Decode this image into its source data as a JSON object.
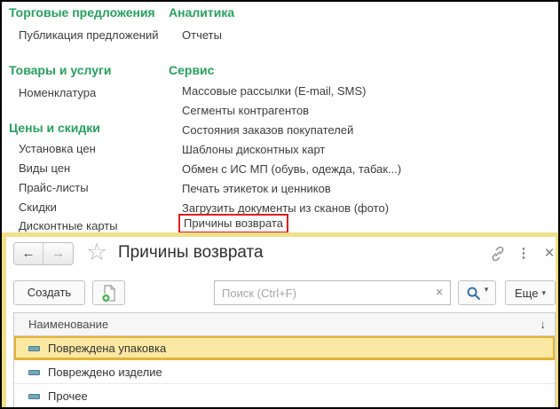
{
  "menu": {
    "col1": {
      "sec1": {
        "title": "Торговые предложения",
        "items": [
          "Публикация предложений"
        ]
      },
      "sec2": {
        "title": "Товары и услуги",
        "items": [
          "Номенклатура"
        ]
      },
      "sec3": {
        "title": "Цены и скидки",
        "items": [
          "Установка цен",
          "Виды цен",
          "Прайс-листы",
          "Скидки",
          "Дисконтные карты"
        ]
      }
    },
    "col2": {
      "sec1": {
        "title": "Аналитика",
        "items": [
          "Отчеты"
        ]
      },
      "sec2": {
        "title": "Сервис",
        "items": [
          "Массовые рассылки (E-mail, SMS)",
          "Сегменты контрагентов",
          "Состояния заказов покупателей",
          "Шаблоны дисконтных карт",
          "Обмен с ИС МП (обувь, одежда, табак...)",
          "Печать этикеток и ценников",
          "Загрузить документы из сканов (фото)",
          "Причины возврата"
        ]
      }
    },
    "highlighted_item": "Причины возврата"
  },
  "window": {
    "title": "Причины возврата",
    "toolbar": {
      "create": "Создать",
      "search_placeholder": "Поиск (Ctrl+F)",
      "more": "Еще"
    },
    "table": {
      "header": "Наименование",
      "rows": [
        "Повреждена упаковка",
        "Повреждено изделие",
        "Прочее"
      ],
      "selected_row": "Повреждена упаковка"
    }
  },
  "icons": {
    "back": "←",
    "forward": "→",
    "favorite_star": "☆",
    "link": "link-chain",
    "more_vertical": "⋮",
    "close": "×",
    "search_clear": "×",
    "dropdown_caret": "▾",
    "sort_descending": "↓"
  },
  "colors": {
    "section_header_green": "#27a05e",
    "window_frame_yellow": "#f1df8a",
    "selected_row_bg": "#fbe8a2",
    "selected_row_border": "#e3b435",
    "highlight_red": "#e31e1e",
    "magnifier_blue": "#2e6da4",
    "row_icon_teal": "#74a7ba"
  }
}
